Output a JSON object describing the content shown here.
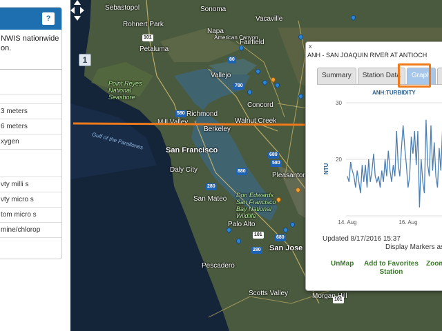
{
  "sidebar": {
    "help_label": "?",
    "desc_line1": "NWIS nationwide",
    "desc_line2": "on.",
    "rows": [
      "3 meters",
      "6 meters",
      "xygen",
      "vty milli s",
      "vty micro s",
      "tom micro s",
      "mine/chlorop"
    ]
  },
  "map": {
    "layers_label": "1",
    "places": {
      "sebastopol": "Sebastopol",
      "rohnert_park": "Rohnert Park",
      "petaluma": "Petaluma",
      "sonoma": "Sonoma",
      "napa": "Napa",
      "american_canyon": "American Canyon",
      "vacaville": "Vacaville",
      "fairfield": "Fairfield",
      "vallejo": "Vallejo",
      "point_reyes": "Point Reyes\nNational\nSeashore",
      "concord": "Concord",
      "richmond": "Richmond",
      "mill_valley": "Mill Valley",
      "walnut_creek": "Walnut Creek",
      "berkeley": "Berkeley",
      "gulf": "Gulf of the Farallones",
      "san_francisco": "San Francisco",
      "daly_city": "Daly City",
      "pleasanton": "Pleasanton",
      "san_mateo": "San Mateo",
      "don_edwards": "Don Edwards\nSan Francisco\nBay National\nWildlife",
      "palo_alto": "Palo Alto",
      "san_jose": "San Jose",
      "pescadero": "Pescadero",
      "morgan_hill": "Morgan Hill",
      "scotts_valley": "Scotts Valley"
    },
    "shields": [
      "101",
      "80",
      "780",
      "580",
      "680",
      "880",
      "280",
      "101",
      "280",
      "680",
      "101",
      "580"
    ]
  },
  "popup": {
    "close_label": "x",
    "title": "ANH - SAN JOAQUIN RIVER AT ANTIOCH",
    "tabs": [
      "Summary",
      "Station Data",
      "Graph",
      "Me"
    ],
    "active_tab": "Graph",
    "updated": "Updated 8/17/2016 15:37",
    "display_markers": "Display Markers as V",
    "links": {
      "unmap": "UnMap",
      "favorites": "Add to Favorites\nStation",
      "zoom": "Zoom"
    }
  },
  "chart_data": {
    "type": "line",
    "title": "ANH:TURBIDITY",
    "ylabel": "NTU",
    "ylim": [
      10,
      30
    ],
    "yticks": [
      30,
      20
    ],
    "xticks": [
      "14. Aug",
      "16. Aug"
    ],
    "series": [
      {
        "values": [
          17,
          16,
          19.5,
          18,
          17,
          15,
          18,
          16,
          14,
          19,
          16,
          19,
          15,
          20,
          16,
          18,
          21,
          17,
          16,
          17,
          15,
          18,
          16,
          20,
          17,
          21.5,
          18,
          16,
          19,
          17,
          25,
          19,
          17,
          22,
          26,
          22,
          19,
          15,
          17,
          24,
          21,
          25,
          19,
          25,
          11.5,
          20,
          16,
          14,
          27,
          19,
          17,
          26,
          18,
          23,
          17,
          15,
          22,
          18,
          25,
          22
        ]
      }
    ],
    "color": "#4a7fb5",
    "grid": true
  }
}
